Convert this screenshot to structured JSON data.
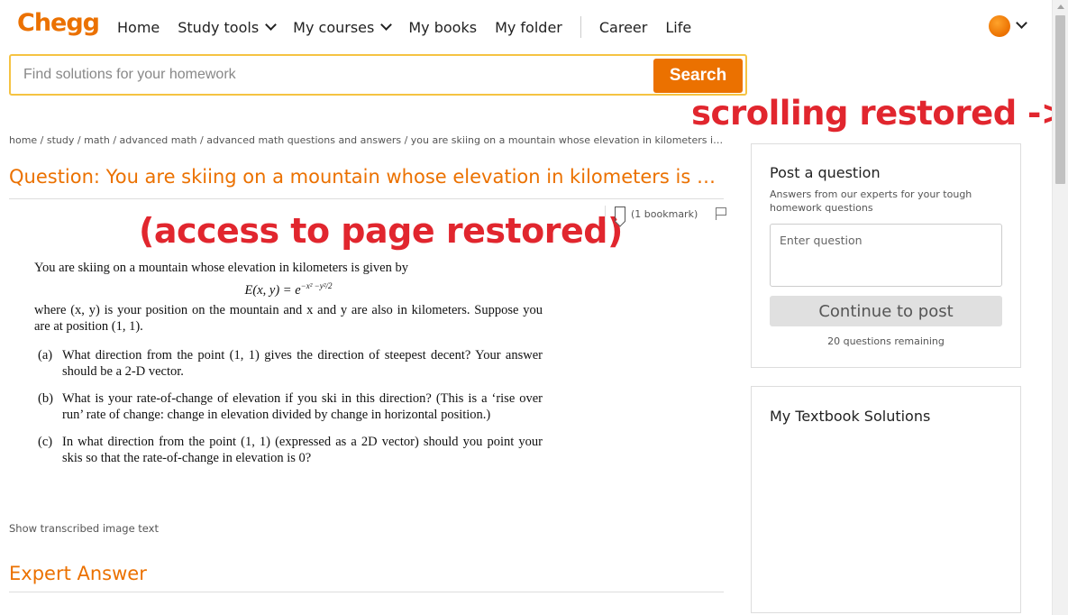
{
  "header": {
    "logo": "Chegg",
    "nav": [
      {
        "label": "Home",
        "dropdown": false
      },
      {
        "label": "Study tools",
        "dropdown": true
      },
      {
        "label": "My courses",
        "dropdown": true
      },
      {
        "label": "My books",
        "dropdown": false
      },
      {
        "label": "My folder",
        "dropdown": false
      }
    ],
    "nav_secondary": [
      {
        "label": "Career"
      },
      {
        "label": "Life"
      }
    ],
    "avatar_icon": "user-avatar-icon"
  },
  "search": {
    "placeholder": "Find solutions for your homework",
    "value": "",
    "button_label": "Search"
  },
  "annotations": {
    "scrolling": "scrolling restored ->",
    "access": "(access to page restored)"
  },
  "breadcrumb": "home / study / math / advanced math / advanced math questions and answers / you are skiing on a mountain whose elevation in kilometers is giv…",
  "question": {
    "title": "Question: You are skiing on a mountain whose elevation in kilometers is giv…",
    "bookmark_label": "(1 bookmark)",
    "intro": "You are skiing on a mountain whose elevation in kilometers is given by",
    "formula_base": "E(x, y) = e",
    "formula_exp": "−x² −y²/2",
    "position_text": "where (x, y) is your position on the mountain and x and y are also in kilometers. Suppose you are at position (1, 1).",
    "parts": [
      {
        "label": "(a)",
        "text": "What direction from the point (1, 1) gives the direction of steepest decent? Your answer should be a 2-D vector."
      },
      {
        "label": "(b)",
        "text": "What is your rate-of-change of elevation if you ski in this direction? (This is a ‘rise over run’ rate of change: change in elevation divided by change in horizontal position.)"
      },
      {
        "label": "(c)",
        "text": "In what direction from the point (1, 1) (expressed as a 2D vector) should you point your skis so that the rate-of-change in elevation is 0?"
      }
    ],
    "show_transcribed": "Show transcribed image text"
  },
  "expert_answer": "Expert Answer",
  "sidebar": {
    "post": {
      "title": "Post a question",
      "subtitle": "Answers from our experts for your tough homework questions",
      "input_placeholder": "Enter question",
      "button_label": "Continue to post",
      "remaining": "20 questions remaining"
    },
    "textbook": {
      "title": "My Textbook Solutions"
    }
  },
  "colors": {
    "brand": "#eb7100",
    "annotation": "#e1262e",
    "search_border": "#f5c342"
  }
}
